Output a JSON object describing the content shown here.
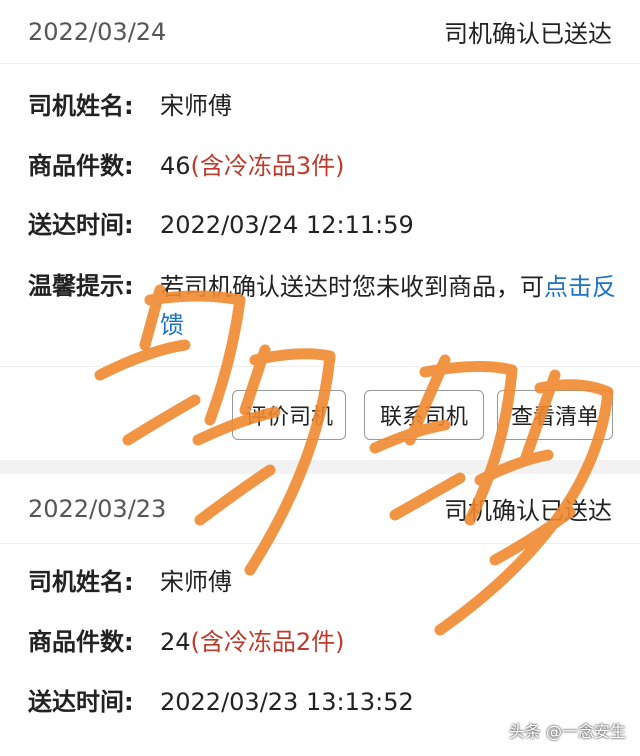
{
  "order1": {
    "date": "2022/03/24",
    "status": "司机确认已送达",
    "driver_label": "司机姓名:",
    "driver_value": "宋师傅",
    "items_label": "商品件数:",
    "items_count": "46",
    "items_note": "(含冷冻品3件)",
    "time_label": "送达时间:",
    "time_value": "2022/03/24 12:11:59",
    "tip_label": "温馨提示:",
    "tip_text": "若司机确认送达时您未收到商品，可",
    "tip_link": "点击反馈",
    "buttons": [
      "评价司机",
      "联系司机",
      "查看清单"
    ]
  },
  "order2": {
    "date": "2022/03/23",
    "status": "司机确认已送达",
    "driver_label": "司机姓名:",
    "driver_value": "宋师傅",
    "items_label": "商品件数:",
    "items_count": "24",
    "items_note": "(含冷冻品2件)",
    "time_label": "送达时间:",
    "time_value": "2022/03/23 13:13:52"
  },
  "watermark": "头条 @一念安生",
  "colors": {
    "accent_red": "#c0392b",
    "link_blue": "#1a73c8",
    "scribble_orange": "#f0892f"
  }
}
